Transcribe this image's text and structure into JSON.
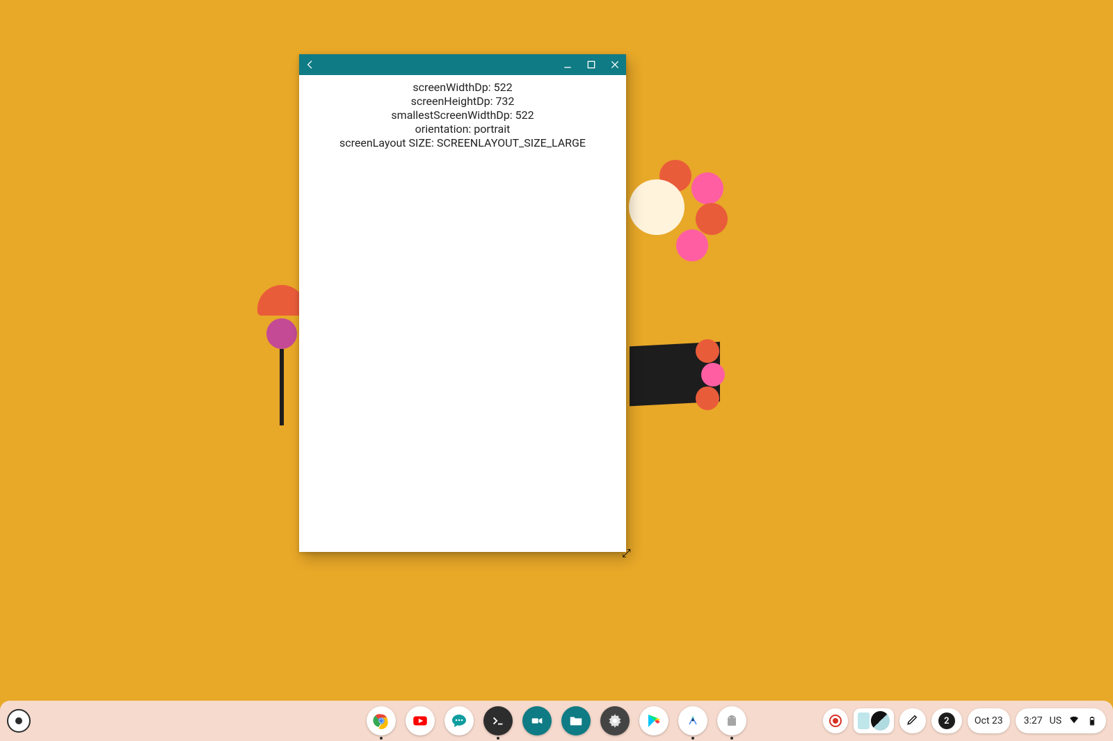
{
  "window": {
    "content": {
      "line1": "screenWidthDp: 522",
      "line2": "screenHeightDp: 732",
      "line3": "smallestScreenWidthDp: 522",
      "line4": "orientation: portrait",
      "line5": "screenLayout SIZE: SCREENLAYOUT_SIZE_LARGE"
    }
  },
  "shelf": {
    "apps": [
      {
        "name": "chrome"
      },
      {
        "name": "youtube"
      },
      {
        "name": "messages"
      },
      {
        "name": "terminal"
      },
      {
        "name": "zoom"
      },
      {
        "name": "files"
      },
      {
        "name": "settings"
      },
      {
        "name": "play-store"
      },
      {
        "name": "android-studio"
      },
      {
        "name": "android"
      }
    ]
  },
  "status": {
    "notification_count": "2",
    "date": "Oct 23",
    "time": "3:27",
    "locale": "US"
  }
}
